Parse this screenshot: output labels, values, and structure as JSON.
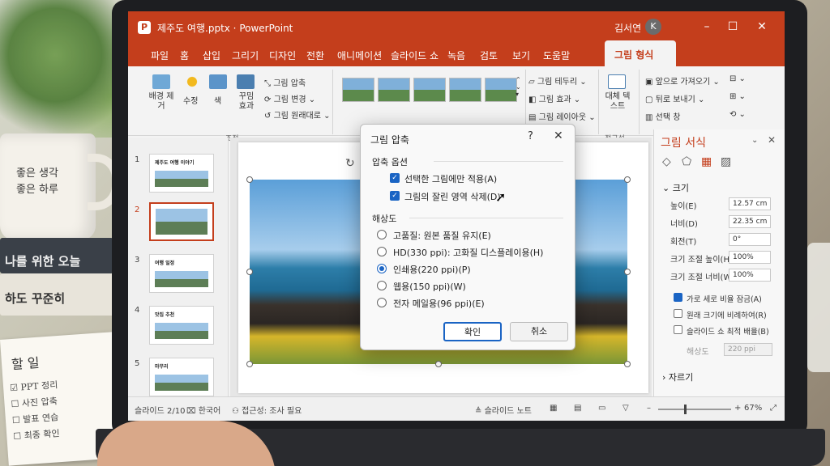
{
  "colors": {
    "accent": "#c43e1c",
    "checkbox": "#1a64c4"
  },
  "scene": {
    "mug_line1": "좋은 생각",
    "mug_line2": "좋은 하루",
    "book1": "나를 위한 오늘",
    "book2": "하도 꾸준히",
    "notepad": {
      "heading": "할 일",
      "items": [
        "PPT 정리",
        "사진 압축",
        "발표 연습",
        "최종 확인"
      ]
    }
  },
  "titlebar": {
    "app_icon": "P",
    "title": "제주도 여행.pptx · PowerPoint",
    "user": "김서연",
    "avatar": "K",
    "minimize": "–",
    "maximize": "☐",
    "close": "✕"
  },
  "tabs": [
    "파일",
    "홈",
    "삽입",
    "그리기",
    "디자인",
    "전환",
    "애니메이션",
    "슬라이드 쇼",
    "녹음",
    "검토",
    "보기",
    "도움말",
    "그림 형식"
  ],
  "ribbon": {
    "remove_bg": "배경 제거",
    "corrections": "수정",
    "color": "색",
    "artistic": "꾸밈 효과",
    "compress": "그림 압축",
    "change": "그림 변경",
    "reset": "그림 원래대로",
    "adjust_group": "조정",
    "border": "그림 테두리",
    "effects": "그림 효과",
    "layout": "그림 레이아웃",
    "alt_text": "대체 텍스트",
    "accessibility_group": "접근성",
    "bring_forward": "앞으로 가져오기",
    "send_backward": "뒤로 보내기",
    "selection_pane": "선택 창",
    "arrange_group": "정렬"
  },
  "thumbnails": [
    {
      "num": "1",
      "title": "제주도 여행 이야기"
    },
    {
      "num": "2",
      "title": ""
    },
    {
      "num": "3",
      "title": "여행 일정"
    },
    {
      "num": "4",
      "title": "맛집 추천"
    },
    {
      "num": "5",
      "title": "마무리"
    }
  ],
  "dialog": {
    "title": "그림 압축",
    "help": "?",
    "close": "✕",
    "options_heading": "압축 옵션",
    "opt1": "선택한 그림에만 적용(A)",
    "opt2": "그림의 잘린 영역 삭제(D)",
    "resolution_heading": "해상도",
    "res": [
      "고품질: 원본 품질 유지(E)",
      "HD(330 ppi): 고화질 디스플레이용(H)",
      "인쇄용(220 ppi)(P)",
      "웹용(150 ppi)(W)",
      "전자 메일용(96 ppi)(E)"
    ],
    "selected_index": 2,
    "ok": "확인",
    "cancel": "취소"
  },
  "pane": {
    "title": "그림 서식",
    "size_heading": "크기",
    "height_label": "높이(E)",
    "height": "12.57 cm",
    "width_label": "너비(D)",
    "width": "22.35 cm",
    "rotation_label": "회전(T)",
    "rotation": "0°",
    "scale_h_label": "크기 조절 높이(H)",
    "scale_h": "100%",
    "scale_w_label": "크기 조절 너비(W)",
    "scale_w": "100%",
    "lock_aspect": "가로 세로 비율 잠금(A)",
    "relative": "원래 크기에 비례하여(R)",
    "best_scale": "슬라이드 쇼 최적 배율(B)",
    "resolution_label": "해상도",
    "resolution": "220 ppi",
    "crop_heading": "자르기"
  },
  "status": {
    "slide": "슬라이드 2/10",
    "lang": "한국어",
    "access": "접근성: 조사 필요",
    "notes": "슬라이드 노트",
    "zoom": "67%"
  }
}
